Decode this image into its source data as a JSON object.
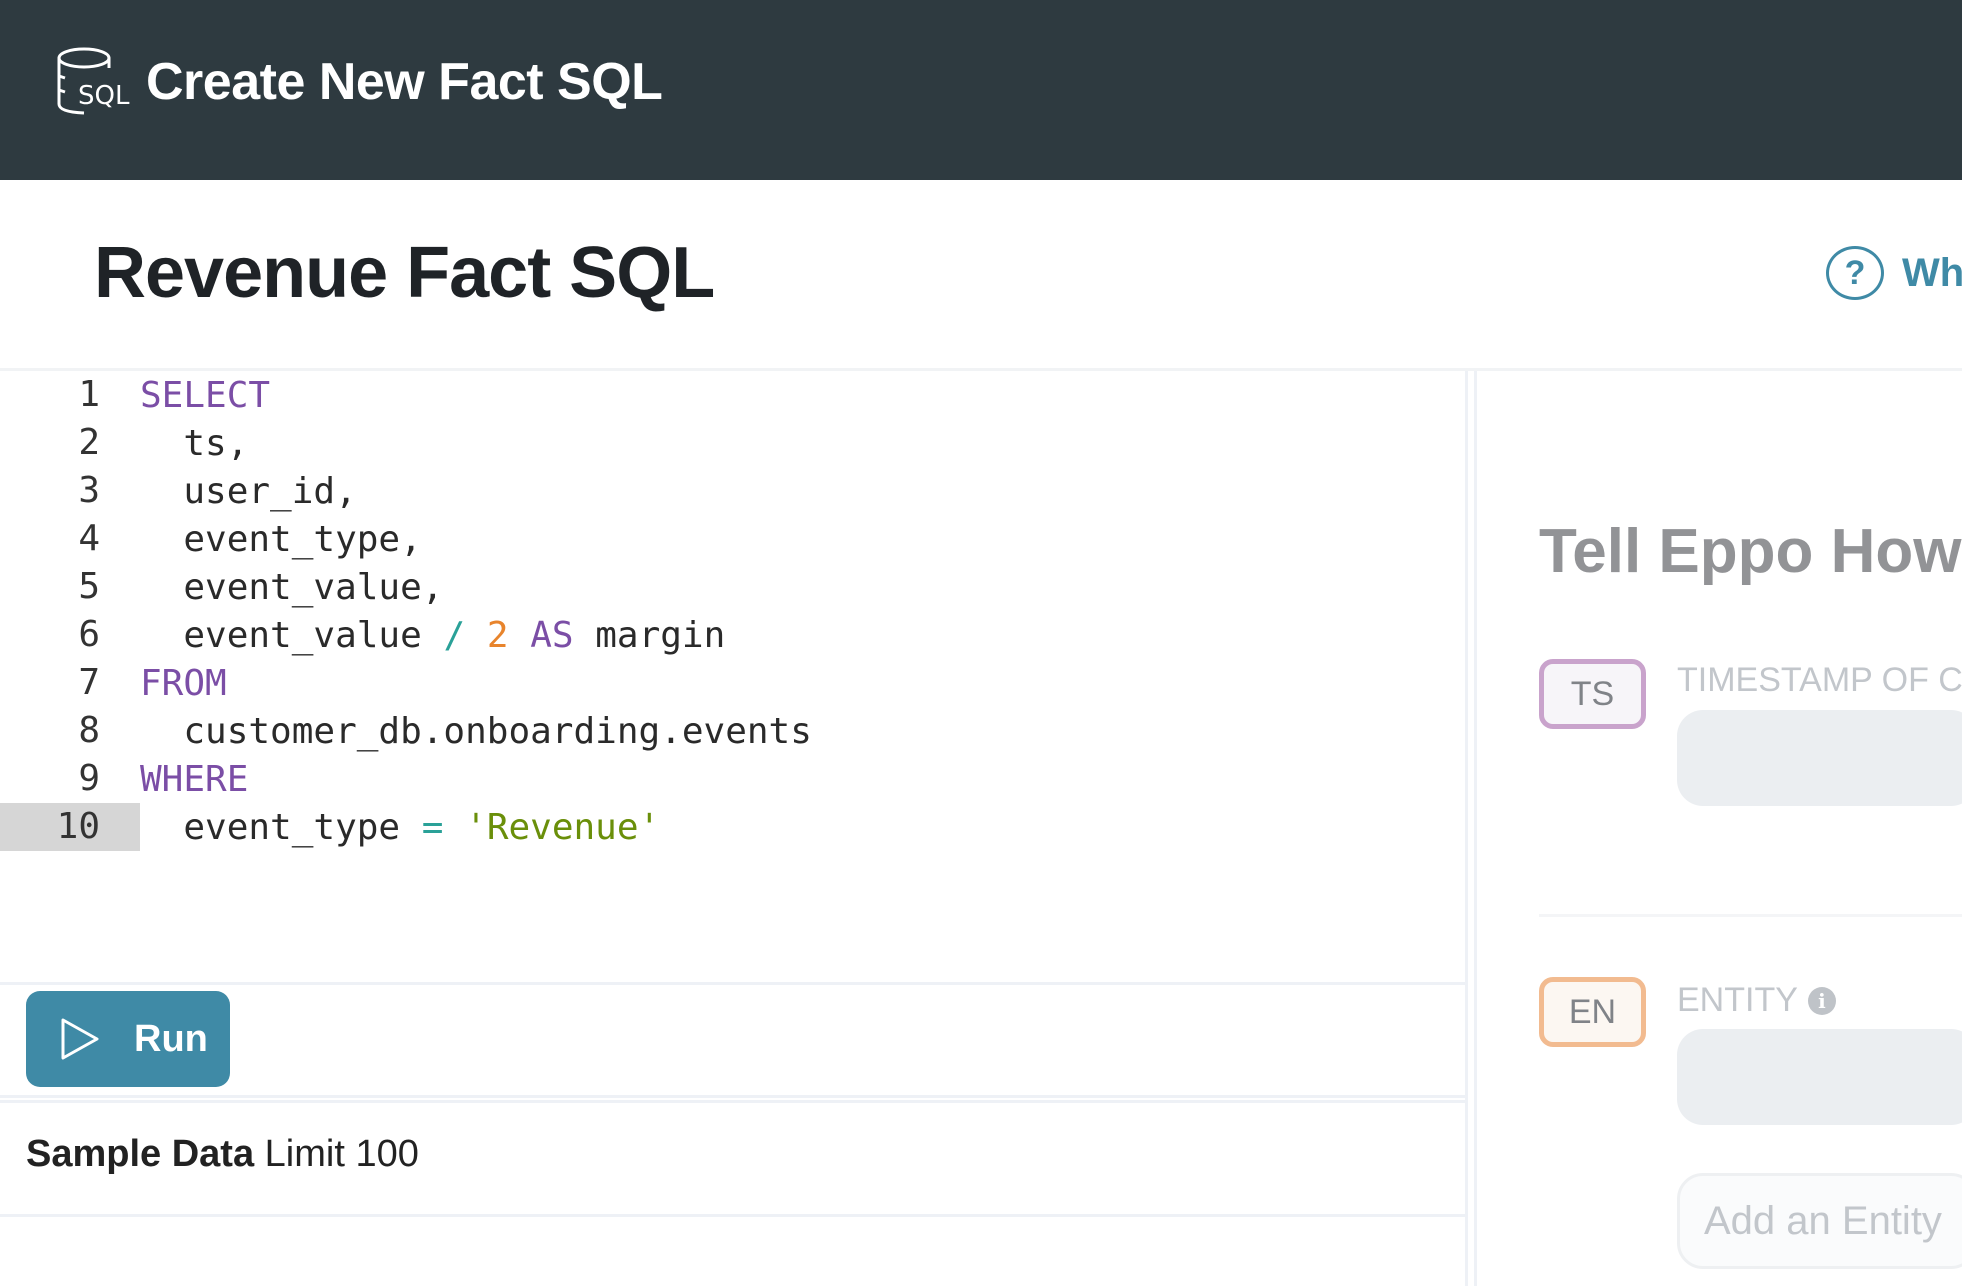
{
  "header": {
    "title": "Create New Fact SQL",
    "icon": "sql-database-icon"
  },
  "page": {
    "title": "Revenue Fact SQL",
    "help_link": "Wh"
  },
  "editor": {
    "lines": [
      {
        "n": "1",
        "tokens": [
          {
            "t": "SELECT",
            "c": "kw"
          }
        ]
      },
      {
        "n": "2",
        "tokens": [
          {
            "t": "  ts,",
            "c": ""
          }
        ]
      },
      {
        "n": "3",
        "tokens": [
          {
            "t": "  user_id,",
            "c": ""
          }
        ]
      },
      {
        "n": "4",
        "tokens": [
          {
            "t": "  event_type,",
            "c": ""
          }
        ]
      },
      {
        "n": "5",
        "tokens": [
          {
            "t": "  event_value,",
            "c": ""
          }
        ]
      },
      {
        "n": "6",
        "tokens": [
          {
            "t": "  event_value ",
            "c": ""
          },
          {
            "t": "/",
            "c": "op"
          },
          {
            "t": " ",
            "c": ""
          },
          {
            "t": "2",
            "c": "num"
          },
          {
            "t": " ",
            "c": ""
          },
          {
            "t": "AS",
            "c": "kw"
          },
          {
            "t": " margin",
            "c": ""
          }
        ]
      },
      {
        "n": "7",
        "tokens": [
          {
            "t": "FROM",
            "c": "kw"
          }
        ]
      },
      {
        "n": "8",
        "tokens": [
          {
            "t": "  customer_db.onboarding.events",
            "c": ""
          }
        ]
      },
      {
        "n": "9",
        "tokens": [
          {
            "t": "WHERE",
            "c": "kw"
          }
        ]
      },
      {
        "n": "10",
        "tokens": [
          {
            "t": "  event_type ",
            "c": ""
          },
          {
            "t": "=",
            "c": "op"
          },
          {
            "t": " ",
            "c": ""
          },
          {
            "t": "'Revenue'",
            "c": "str"
          }
        ],
        "active": true
      }
    ]
  },
  "run_button": {
    "label": "Run"
  },
  "sample": {
    "bold": "Sample Data",
    "rest": " Limit 100"
  },
  "right_panel": {
    "title": "Tell Eppo How",
    "timestamp": {
      "badge": "TS",
      "label": "TIMESTAMP OF CR"
    },
    "entity": {
      "badge": "EN",
      "label": "ENTITY",
      "info": "i"
    },
    "add_entity": "Add an Entity"
  }
}
